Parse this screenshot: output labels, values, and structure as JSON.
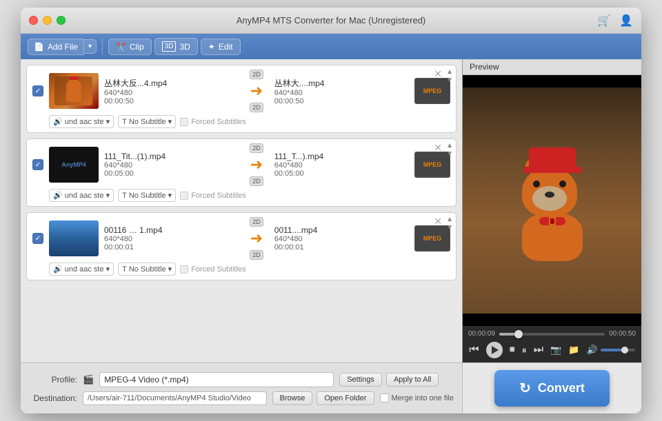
{
  "window": {
    "title": "AnyMP4 MTS Converter for Mac (Unregistered)"
  },
  "toolbar": {
    "add_file": "Add File",
    "clip": "Clip",
    "label_3d": "3D",
    "edit": "Edit"
  },
  "preview": {
    "title": "Preview",
    "time_current": "00:00:09",
    "time_total": "00:00:50"
  },
  "files": [
    {
      "id": 1,
      "name_input": "丛林大反...4.mp4",
      "name_output": "丛林大....mp4",
      "resolution": "640*480",
      "duration": "00:00:50",
      "audio": "und aac ste",
      "subtitle": "No Subtitle",
      "forced_subs": "Forced Subtitles",
      "badge": "MPEG",
      "has_thumb": true,
      "thumb_type": "bear"
    },
    {
      "id": 2,
      "name_input": "111_Tit...(1).mp4",
      "name_output": "111_T...).mp4",
      "resolution": "640*480",
      "duration": "00:05:00",
      "audio": "und aac ste",
      "subtitle": "No Subtitle",
      "forced_subs": "Forced Subtitles",
      "badge": "MPEG",
      "has_thumb": false,
      "thumb_type": "black"
    },
    {
      "id": 3,
      "name_input": "00116 … 1.mp4",
      "name_output": "0011....mp4",
      "resolution": "640*480",
      "duration": "00:00:01",
      "audio": "und aac ste",
      "subtitle": "No Subtitle",
      "forced_subs": "Forced Subtitles",
      "badge": "MPEG",
      "has_thumb": true,
      "thumb_type": "lake"
    }
  ],
  "bottom": {
    "profile_label": "Profile:",
    "profile_value": "MPEG-4 Video (*.mp4)",
    "settings_btn": "Settings",
    "apply_all_btn": "Apply to All",
    "dest_label": "Destination:",
    "dest_path": "/Users/air-711/Documents/AnyMP4 Studio/Video",
    "browse_btn": "Browse",
    "open_folder_btn": "Open Folder",
    "merge_label": "Merge into one file"
  },
  "convert": {
    "label": "Convert"
  }
}
